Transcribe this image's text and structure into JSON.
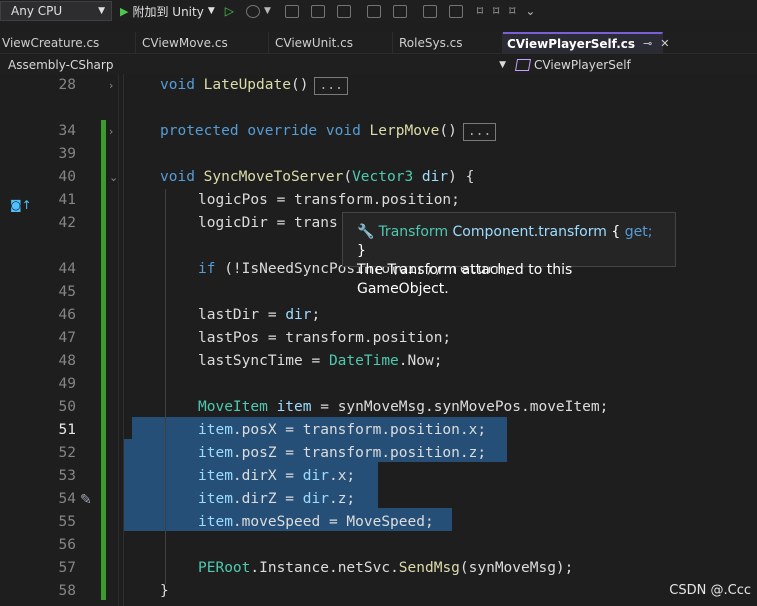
{
  "toolbar": {
    "platform_value": "Any CPU",
    "attach_label": "附加到 Unity",
    "icon_names": [
      "dropdown-arrow-icon",
      "play-icon",
      "step-play-icon",
      "refresh-icon",
      "find-icon",
      "layout-icon",
      "spellcheck-icon",
      "comment-icon",
      "format-icon",
      "indent-icon",
      "outdent-icon",
      "bookmark-icon",
      "bookmark-prev-icon",
      "bookmark-next-icon",
      "more-icon"
    ]
  },
  "tabs": [
    {
      "label": "ViewCreature.cs",
      "active": false
    },
    {
      "label": "CViewMove.cs",
      "active": false
    },
    {
      "label": "CViewUnit.cs",
      "active": false
    },
    {
      "label": "RoleSys.cs",
      "active": false
    },
    {
      "label": "CViewPlayerSelf.cs",
      "active": true
    }
  ],
  "tab_pin_glyph": "⊸",
  "tab_close_glyph": "✕",
  "navbar": {
    "project": "Assembly-CSharp",
    "class_name": "CViewPlayerSelf"
  },
  "editor": {
    "current_line": 51,
    "collapsed_marker": "...",
    "lines": [
      {
        "n": "28",
        "fold": "›"
      },
      {
        "n": "34",
        "fold": "›"
      },
      {
        "n": "39",
        "fold": ""
      },
      {
        "n": "40",
        "fold": "⌄"
      },
      {
        "n": "41",
        "fold": ""
      },
      {
        "n": "42",
        "fold": ""
      },
      {
        "n": "44",
        "fold": ""
      },
      {
        "n": "45",
        "fold": ""
      },
      {
        "n": "46",
        "fold": ""
      },
      {
        "n": "47",
        "fold": ""
      },
      {
        "n": "48",
        "fold": ""
      },
      {
        "n": "49",
        "fold": ""
      },
      {
        "n": "50",
        "fold": ""
      },
      {
        "n": "51",
        "fold": ""
      },
      {
        "n": "52",
        "fold": ""
      },
      {
        "n": "53",
        "fold": ""
      },
      {
        "n": "54",
        "fold": ""
      },
      {
        "n": "55",
        "fold": ""
      },
      {
        "n": "56",
        "fold": ""
      },
      {
        "n": "57",
        "fold": ""
      },
      {
        "n": "58",
        "fold": ""
      }
    ],
    "code": {
      "l28": {
        "kw": "void",
        "fn": "LateUpdate",
        "rest": "()"
      },
      "l34": {
        "kw1": "protected",
        "kw2": "override",
        "kw3": "void",
        "fn": "LerpMove",
        "rest": "()"
      },
      "l40": {
        "kw": "void",
        "fn": "SyncMoveToServer",
        "open": "(",
        "type": "Vector3",
        "param": "dir",
        "close": ") {"
      },
      "l41": "logicPos = transform.position;",
      "l42": "logicDir = trans",
      "l44": {
        "kw": "if",
        "rest": " (!IsNeedSyncPosInfo(dir)) return;"
      },
      "l46a": "lastDir = ",
      "l46b": "dir",
      "l46c": ";",
      "l47": "lastPos = transform.position;",
      "l48a": "lastSyncTime = ",
      "l48b": "DateTime",
      "l48c": ".Now;",
      "l50a": "MoveItem",
      "l50b": " item",
      "l50c": " = synMoveMsg.synMovePos.moveItem;",
      "l51a": "item",
      "l51b": ".posX = transform.position.x;",
      "l52a": "item",
      "l52b": ".posZ = transform.position.z;",
      "l53a": "item",
      "l53b": ".dirX = ",
      "l53c": "dir",
      "l53d": ".x;",
      "l54a": "item",
      "l54b": ".dirZ = ",
      "l54c": "dir",
      "l54d": ".z;",
      "l55a": "item",
      "l55b": ".moveSpeed = MoveSpeed;",
      "l57a": "PERoot",
      "l57b": ".Instance.netSvc.",
      "l57c": "SendMsg",
      "l57d": "(synMoveMsg);",
      "l58": "}"
    }
  },
  "tooltip": {
    "type_name": "Transform",
    "member": " Component.transform ",
    "accessor_open": "{ ",
    "accessor": "get;",
    "accessor_close": " }",
    "description": "The Transform attached to this GameObject."
  },
  "watermark": "CSDN @.Ccc",
  "colors": {
    "keyword": "#569cd6",
    "type": "#4ec9b0",
    "method": "#dcdcaa",
    "variable": "#9cdcfe",
    "selection": "#264f78",
    "change_bar": "#3b9b2d",
    "active_tab_accent": "#7a5fd6"
  }
}
